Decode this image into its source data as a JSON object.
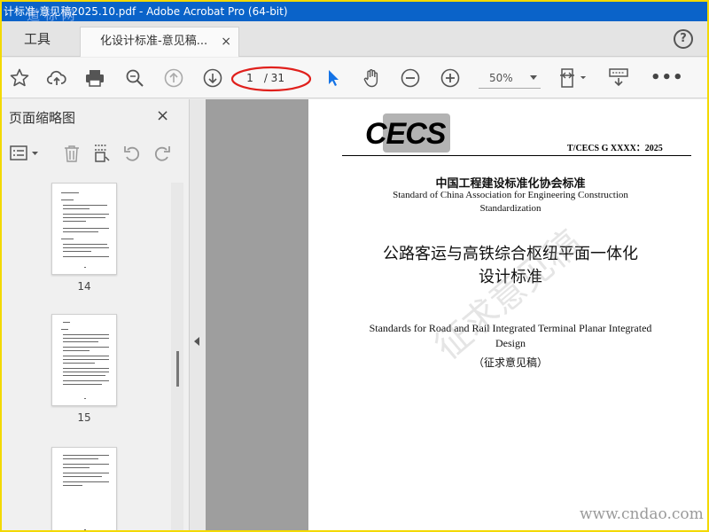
{
  "window": {
    "title": "计标准-意见稿2025.10.pdf - Adobe Acrobat Pro (64-bit)",
    "corner_watermark": "道 标 网"
  },
  "tabs": {
    "tools_label": "工具",
    "document_label": "化设计标准-意见稿...",
    "close_glyph": "×",
    "help_glyph": "?"
  },
  "toolbar": {
    "icons": [
      "star-icon",
      "cloud-upload-icon",
      "print-icon",
      "zoom-search-icon",
      "page-up-icon",
      "page-down-icon",
      "select-arrow-icon",
      "hand-tool-icon",
      "zoom-out-icon",
      "zoom-in-icon",
      "fit-page-icon",
      "scan-icon",
      "more-icon"
    ],
    "current_page": "1",
    "total_pages": "/ 31",
    "zoom": "50%",
    "more_glyph": "•••",
    "highlight_color": "#e0201c",
    "select_color": "#1473e6"
  },
  "sidebar": {
    "title": "页面缩略图",
    "close_glyph": "×",
    "tool_icons": [
      "options-menu-icon",
      "delete-icon",
      "extract-page-icon",
      "rotate-ccw-icon",
      "rotate-cw-icon"
    ],
    "thumbnails": [
      {
        "label": "14"
      },
      {
        "label": "15"
      },
      {
        "label": ""
      }
    ]
  },
  "document": {
    "logo_text": "CECS",
    "standard_code": "T/CECS G XXXX：2025",
    "org_cn": "中国工程建设标准化协会标准",
    "org_en": "Standard of China Association for Engineering Construction Standardization",
    "title_cn_line1": "公路客运与高铁综合枢纽平面一体化",
    "title_cn_line2": "设计标准",
    "title_en": "Standards for Road and Rail Integrated Terminal Planar Integrated Design",
    "status_cn": "（征求意见稿）",
    "watermark": "征求意见稿"
  },
  "site_watermark": "www.cndao.com",
  "colors": {
    "titlebar": "#0a63c9",
    "outer_border": "#f3d900",
    "doc_gray": "#9e9e9e"
  }
}
